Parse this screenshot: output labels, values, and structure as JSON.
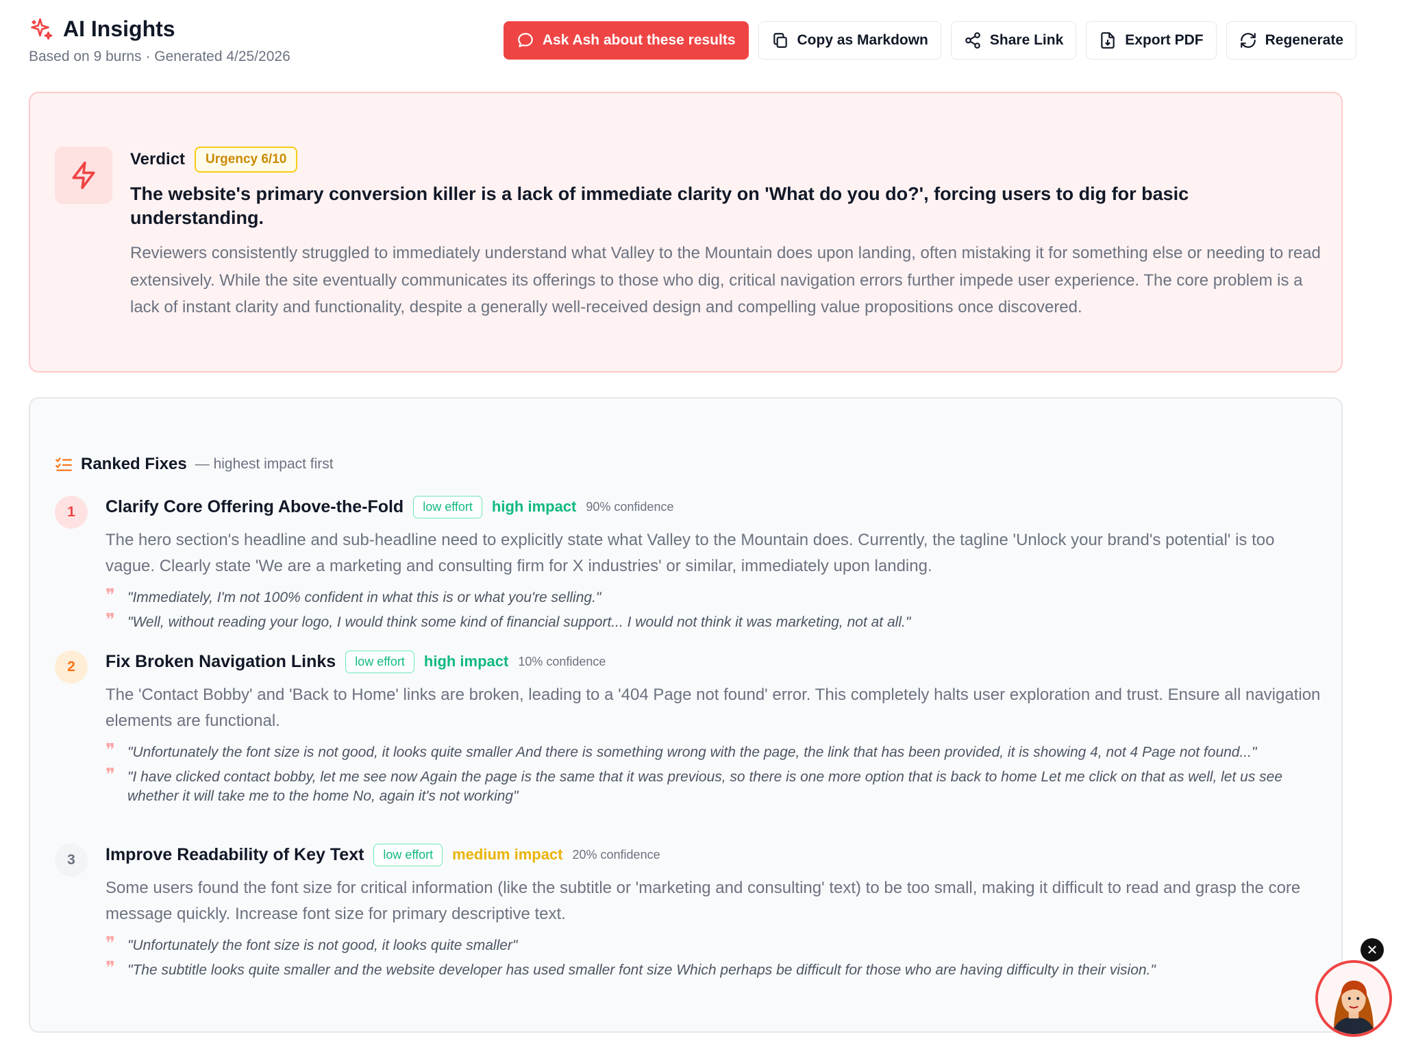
{
  "header": {
    "title": "AI Insights",
    "subtitle": "Based on 9 burns · Generated 4/25/2026",
    "actions": {
      "ask": "Ask Ash about these results",
      "copy": "Copy as Markdown",
      "share": "Share Link",
      "export": "Export PDF",
      "regenerate": "Regenerate"
    }
  },
  "verdict": {
    "label": "Verdict",
    "urgency": "Urgency 6/10",
    "headline": "The website's primary conversion killer is a lack of immediate clarity on 'What do you do?', forcing users to dig for basic understanding.",
    "text": "Reviewers consistently struggled to immediately understand what Valley to the Mountain does upon landing, often mistaking it for something else or needing to read extensively. While the site eventually communicates its offerings to those who dig, critical navigation errors further impede user experience. The core problem is a lack of instant clarity and functionality, despite a generally well-received design and compelling value propositions once discovered."
  },
  "fixes": {
    "title": "Ranked Fixes",
    "subtitle": "— highest impact first",
    "items": [
      {
        "num": "1",
        "title": "Clarify Core Offering Above-the-Fold",
        "effort": "low effort",
        "impact": "high impact",
        "confidence": "90% confidence",
        "desc": "The hero section's headline and sub-headline need to explicitly state what Valley to the Mountain does. Currently, the tagline 'Unlock your brand's potential' is too vague. Clearly state 'We are a marketing and consulting firm for X industries' or similar, immediately upon landing.",
        "quotes": [
          "\"Immediately, I'm not 100% confident in what this is or what you're selling.\"",
          "\"Well, without reading your logo, I would think some kind of financial support... I would not think it was marketing, not at all.\""
        ]
      },
      {
        "num": "2",
        "title": "Fix Broken Navigation Links",
        "effort": "low effort",
        "impact": "high impact",
        "confidence": "10% confidence",
        "desc": "The 'Contact Bobby' and 'Back to Home' links are broken, leading to a '404 Page not found' error. This completely halts user exploration and trust. Ensure all navigation elements are functional.",
        "quotes": [
          "\"Unfortunately the font size is not good, it looks quite smaller And there is something wrong with the page, the link that has been provided, it is showing 4, not 4 Page not found...\"",
          "\"I have clicked contact bobby, let me see now Again the page is the same that it was previous, so there is one more option that is back to home Let me click on that as well, let us see whether it will take me to the home No, again it's not working\""
        ]
      },
      {
        "num": "3",
        "title": "Improve Readability of Key Text",
        "effort": "low effort",
        "impact": "medium impact",
        "confidence": "20% confidence",
        "desc": "Some users found the font size for critical information (like the subtitle or 'marketing and consulting' text) to be too small, making it difficult to read and grasp the core message quickly. Increase font size for primary descriptive text.",
        "quotes": [
          "\"Unfortunately the font size is not good, it looks quite smaller\"",
          "\"The subtitle looks quite smaller and the website developer has used smaller font size Which perhaps be difficult for those who are having difficulty in their vision.\""
        ]
      }
    ]
  },
  "widget": {
    "close": "✕"
  }
}
